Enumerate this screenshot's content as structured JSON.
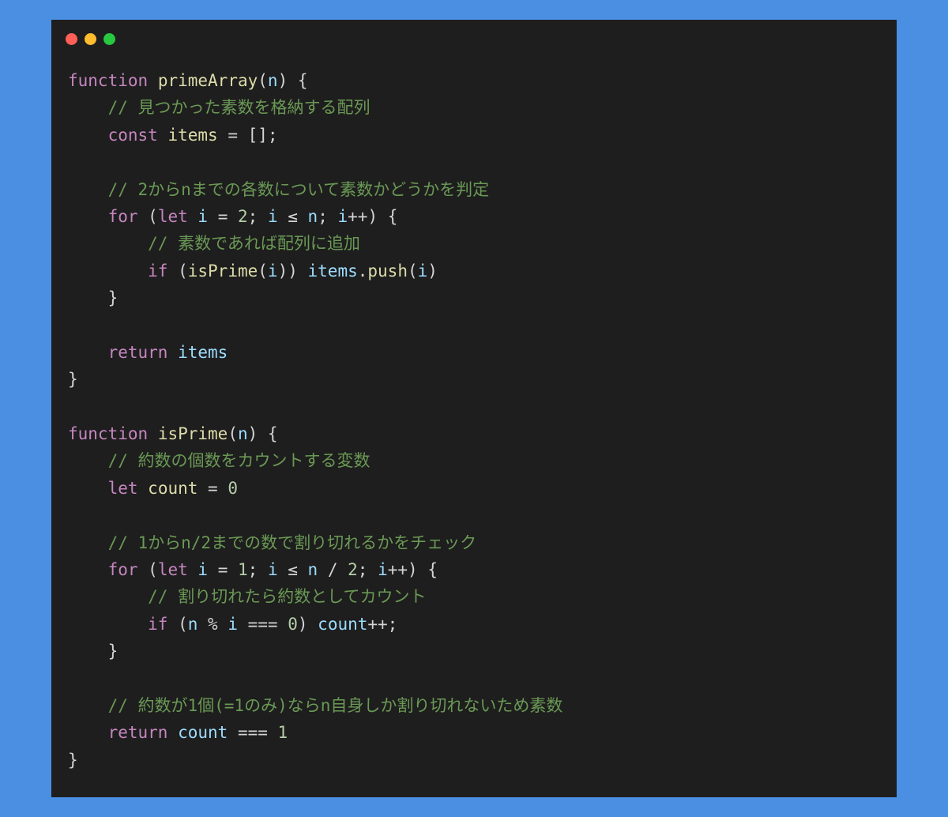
{
  "window": {
    "controls": [
      {
        "name": "close",
        "color": "#ff5f57"
      },
      {
        "name": "minimize",
        "color": "#febc2e"
      },
      {
        "name": "maximize",
        "color": "#28c840"
      }
    ]
  },
  "colors": {
    "background": "#4a8fe2",
    "editor": "#1e1e1e",
    "keyword": "#c586c0",
    "function": "#dcdcaa",
    "variable": "#9cdcfe",
    "number": "#b5cea8",
    "comment": "#6a9955",
    "plain": "#d4d4d4"
  },
  "code": {
    "lines": [
      [
        {
          "t": "keyword",
          "v": "function"
        },
        {
          "t": "plain",
          "v": " "
        },
        {
          "t": "function",
          "v": "primeArray"
        },
        {
          "t": "plain",
          "v": "("
        },
        {
          "t": "variable",
          "v": "n"
        },
        {
          "t": "plain",
          "v": ") {"
        }
      ],
      [
        {
          "t": "plain",
          "v": "    "
        },
        {
          "t": "comment",
          "v": "// 見つかった素数を格納する配列"
        }
      ],
      [
        {
          "t": "plain",
          "v": "    "
        },
        {
          "t": "keyword",
          "v": "const"
        },
        {
          "t": "plain",
          "v": " "
        },
        {
          "t": "function",
          "v": "items"
        },
        {
          "t": "plain",
          "v": " = [];"
        }
      ],
      [],
      [
        {
          "t": "plain",
          "v": "    "
        },
        {
          "t": "comment",
          "v": "// 2からnまでの各数について素数かどうかを判定"
        }
      ],
      [
        {
          "t": "plain",
          "v": "    "
        },
        {
          "t": "keyword",
          "v": "for"
        },
        {
          "t": "plain",
          "v": " ("
        },
        {
          "t": "keyword",
          "v": "let"
        },
        {
          "t": "plain",
          "v": " "
        },
        {
          "t": "variable",
          "v": "i"
        },
        {
          "t": "plain",
          "v": " = "
        },
        {
          "t": "number",
          "v": "2"
        },
        {
          "t": "plain",
          "v": "; "
        },
        {
          "t": "variable",
          "v": "i"
        },
        {
          "t": "plain",
          "v": " ≤ "
        },
        {
          "t": "variable",
          "v": "n"
        },
        {
          "t": "plain",
          "v": "; "
        },
        {
          "t": "variable",
          "v": "i"
        },
        {
          "t": "plain",
          "v": "++) {"
        }
      ],
      [
        {
          "t": "plain",
          "v": "        "
        },
        {
          "t": "comment",
          "v": "// 素数であれば配列に追加"
        }
      ],
      [
        {
          "t": "plain",
          "v": "        "
        },
        {
          "t": "keyword",
          "v": "if"
        },
        {
          "t": "plain",
          "v": " ("
        },
        {
          "t": "function",
          "v": "isPrime"
        },
        {
          "t": "plain",
          "v": "("
        },
        {
          "t": "variable",
          "v": "i"
        },
        {
          "t": "plain",
          "v": ")) "
        },
        {
          "t": "variable",
          "v": "items"
        },
        {
          "t": "plain",
          "v": "."
        },
        {
          "t": "function",
          "v": "push"
        },
        {
          "t": "plain",
          "v": "("
        },
        {
          "t": "variable",
          "v": "i"
        },
        {
          "t": "plain",
          "v": ")"
        }
      ],
      [
        {
          "t": "plain",
          "v": "    }"
        }
      ],
      [],
      [
        {
          "t": "plain",
          "v": "    "
        },
        {
          "t": "keyword",
          "v": "return"
        },
        {
          "t": "plain",
          "v": " "
        },
        {
          "t": "variable",
          "v": "items"
        }
      ],
      [
        {
          "t": "plain",
          "v": "}"
        }
      ],
      [],
      [
        {
          "t": "keyword",
          "v": "function"
        },
        {
          "t": "plain",
          "v": " "
        },
        {
          "t": "function",
          "v": "isPrime"
        },
        {
          "t": "plain",
          "v": "("
        },
        {
          "t": "variable",
          "v": "n"
        },
        {
          "t": "plain",
          "v": ") {"
        }
      ],
      [
        {
          "t": "plain",
          "v": "    "
        },
        {
          "t": "comment",
          "v": "// 約数の個数をカウントする変数"
        }
      ],
      [
        {
          "t": "plain",
          "v": "    "
        },
        {
          "t": "keyword",
          "v": "let"
        },
        {
          "t": "plain",
          "v": " "
        },
        {
          "t": "function",
          "v": "count"
        },
        {
          "t": "plain",
          "v": " = "
        },
        {
          "t": "number",
          "v": "0"
        }
      ],
      [],
      [
        {
          "t": "plain",
          "v": "    "
        },
        {
          "t": "comment",
          "v": "// 1からn/2までの数で割り切れるかをチェック"
        }
      ],
      [
        {
          "t": "plain",
          "v": "    "
        },
        {
          "t": "keyword",
          "v": "for"
        },
        {
          "t": "plain",
          "v": " ("
        },
        {
          "t": "keyword",
          "v": "let"
        },
        {
          "t": "plain",
          "v": " "
        },
        {
          "t": "variable",
          "v": "i"
        },
        {
          "t": "plain",
          "v": " = "
        },
        {
          "t": "number",
          "v": "1"
        },
        {
          "t": "plain",
          "v": "; "
        },
        {
          "t": "variable",
          "v": "i"
        },
        {
          "t": "plain",
          "v": " ≤ "
        },
        {
          "t": "variable",
          "v": "n"
        },
        {
          "t": "plain",
          "v": " / "
        },
        {
          "t": "number",
          "v": "2"
        },
        {
          "t": "plain",
          "v": "; "
        },
        {
          "t": "variable",
          "v": "i"
        },
        {
          "t": "plain",
          "v": "++) {"
        }
      ],
      [
        {
          "t": "plain",
          "v": "        "
        },
        {
          "t": "comment",
          "v": "// 割り切れたら約数としてカウント"
        }
      ],
      [
        {
          "t": "plain",
          "v": "        "
        },
        {
          "t": "keyword",
          "v": "if"
        },
        {
          "t": "plain",
          "v": " ("
        },
        {
          "t": "variable",
          "v": "n"
        },
        {
          "t": "plain",
          "v": " % "
        },
        {
          "t": "variable",
          "v": "i"
        },
        {
          "t": "plain",
          "v": " === "
        },
        {
          "t": "number",
          "v": "0"
        },
        {
          "t": "plain",
          "v": ") "
        },
        {
          "t": "variable",
          "v": "count"
        },
        {
          "t": "plain",
          "v": "++;"
        }
      ],
      [
        {
          "t": "plain",
          "v": "    }"
        }
      ],
      [],
      [
        {
          "t": "plain",
          "v": "    "
        },
        {
          "t": "comment",
          "v": "// 約数が1個(=1のみ)ならn自身しか割り切れないため素数"
        }
      ],
      [
        {
          "t": "plain",
          "v": "    "
        },
        {
          "t": "keyword",
          "v": "return"
        },
        {
          "t": "plain",
          "v": " "
        },
        {
          "t": "variable",
          "v": "count"
        },
        {
          "t": "plain",
          "v": " === "
        },
        {
          "t": "number",
          "v": "1"
        }
      ],
      [
        {
          "t": "plain",
          "v": "}"
        }
      ]
    ]
  }
}
